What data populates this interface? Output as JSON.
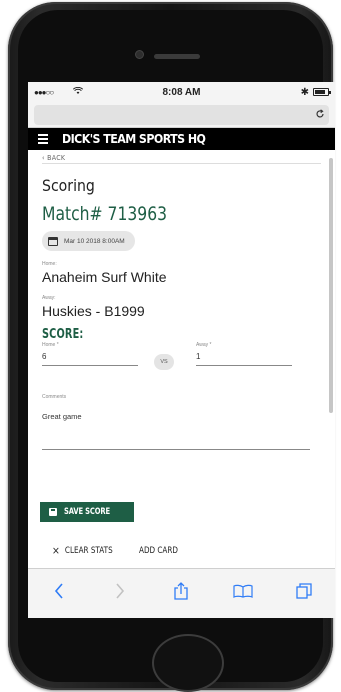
{
  "status_bar": {
    "signal": "●●●○○",
    "wifi": "wifi-icon",
    "time": "8:08 AM",
    "bluetooth": "✱",
    "battery_level": 0.8
  },
  "browser": {
    "reload_icon": "reload-icon"
  },
  "header": {
    "brand": "DICK'S TEAM SPORTS HQ"
  },
  "page": {
    "back": "‹ BACK",
    "title": "Scoring",
    "match": "Match# 713963",
    "date": "Mar 10 2018 8:00AM",
    "home_label": "Home:",
    "home_team": "Anaheim Surf White",
    "away_label": "Away:",
    "away_team": "Huskies - B1999",
    "score_title": "SCORE:",
    "score_home_label": "Home *",
    "score_home": "6",
    "vs": "VS",
    "score_away_label": "Away *",
    "score_away": "1",
    "comments_label": "Comments",
    "comments": "Great game"
  },
  "actions": {
    "save": "SAVE SCORE",
    "clear": "CLEAR STATS",
    "add_card": "ADD CARD"
  },
  "colors": {
    "accent": "#1e5e45",
    "safari_blue": "#2f7cf6"
  }
}
